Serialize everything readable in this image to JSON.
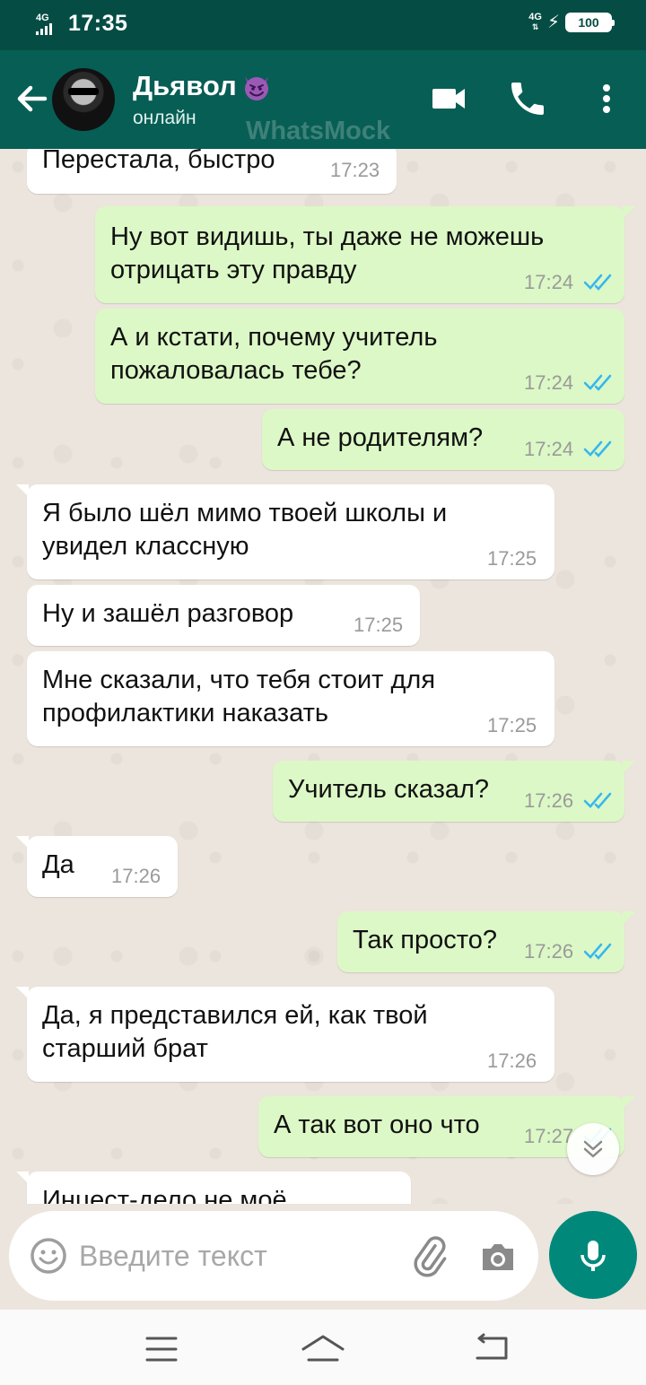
{
  "status_bar": {
    "network_left": "4G",
    "time": "17:35",
    "network_right": "4G",
    "battery": "100"
  },
  "header": {
    "contact_name": "Дьявол",
    "status": "онлайн",
    "watermark": "WhatsMock",
    "icons": [
      "back-arrow-icon",
      "video-call-icon",
      "phone-icon",
      "more-vert-icon"
    ],
    "colors": {
      "status_bar": "#054D44",
      "header": "#075E54",
      "outgoing": "#DCF8C6",
      "incoming": "#FFFFFF",
      "ticks": "#34B7F1",
      "mic": "#00897B"
    }
  },
  "messages": [
    {
      "dir": "in",
      "lines": [
        "Перестала, быстро"
      ],
      "time": "17:23",
      "ticks": false
    },
    {
      "dir": "out",
      "lines": [
        "Ну вот видишь, ты даже не можешь",
        "отрицать эту правду"
      ],
      "time": "17:24",
      "ticks": true
    },
    {
      "dir": "out",
      "lines": [
        "А и кстати, почему учитель",
        "пожаловалась тебе?"
      ],
      "time": "17:24",
      "ticks": true
    },
    {
      "dir": "out",
      "lines": [
        "А не родителям?"
      ],
      "time": "17:24",
      "ticks": true
    },
    {
      "dir": "in",
      "lines": [
        "Я было шёл мимо твоей школы и",
        "увидел классную"
      ],
      "time": "17:25",
      "ticks": false
    },
    {
      "dir": "in",
      "lines": [
        "Ну и зашёл разговор"
      ],
      "time": "17:25",
      "ticks": false
    },
    {
      "dir": "in",
      "lines": [
        "Мне сказали, что тебя стоит для",
        "профилактики наказать"
      ],
      "time": "17:25",
      "ticks": false
    },
    {
      "dir": "out",
      "lines": [
        "Учитель сказал?"
      ],
      "time": "17:26",
      "ticks": true
    },
    {
      "dir": "in",
      "lines": [
        "Да"
      ],
      "time": "17:26",
      "ticks": false
    },
    {
      "dir": "out",
      "lines": [
        "Так просто?"
      ],
      "time": "17:26",
      "ticks": true
    },
    {
      "dir": "in",
      "lines": [
        "Да, я представился ей, как твой",
        "старший брат"
      ],
      "time": "17:26",
      "ticks": false
    },
    {
      "dir": "out",
      "lines": [
        "А так вот оно что"
      ],
      "time": "17:27",
      "ticks": true
    },
    {
      "dir": "in",
      "lines": [
        "Инцест-дело не моё"
      ],
      "time": "",
      "ticks": false
    }
  ],
  "composer": {
    "placeholder": "Введите текст",
    "icons": [
      "emoji-icon",
      "paperclip-icon",
      "camera-icon",
      "mic-icon"
    ]
  },
  "nav_bar": {
    "icons": [
      "menu-icon",
      "home-icon",
      "back-icon"
    ]
  }
}
